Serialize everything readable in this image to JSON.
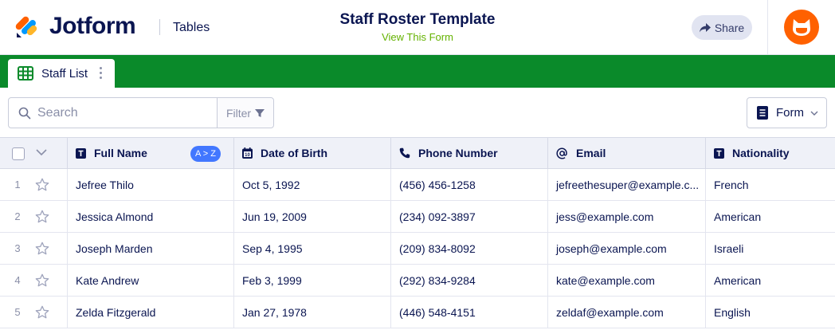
{
  "header": {
    "brand": "Jotform",
    "app_name": "Tables",
    "title": "Staff Roster Template",
    "subtitle": "View This Form",
    "share_label": "Share"
  },
  "tabs": [
    {
      "label": "Staff List",
      "icon": "table-grid-icon"
    }
  ],
  "toolbar": {
    "search_placeholder": "Search",
    "filter_label": "Filter",
    "form_label": "Form"
  },
  "table": {
    "sort_badge": "A > Z",
    "columns": [
      {
        "label": "Full Name",
        "icon": "text-type-icon"
      },
      {
        "label": "Date of Birth",
        "icon": "calendar-icon"
      },
      {
        "label": "Phone Number",
        "icon": "phone-icon"
      },
      {
        "label": "Email",
        "icon": "at-sign-icon"
      },
      {
        "label": "Nationality",
        "icon": "text-type-icon"
      }
    ],
    "rows": [
      {
        "num": "1",
        "name": "Jefree Thilo",
        "dob": "Oct 5, 1992",
        "phone": "(456) 456-1258",
        "email": "jefreethesuper@example.c...",
        "nationality": "French"
      },
      {
        "num": "2",
        "name": "Jessica Almond",
        "dob": "Jun 19, 2009",
        "phone": "(234) 092-3897",
        "email": "jess@example.com",
        "nationality": "American"
      },
      {
        "num": "3",
        "name": "Joseph Marden",
        "dob": "Sep 4, 1995",
        "phone": "(209) 834-8092",
        "email": "joseph@example.com",
        "nationality": "Israeli"
      },
      {
        "num": "4",
        "name": "Kate Andrew",
        "dob": "Feb 3, 1999",
        "phone": "(292) 834-9284",
        "email": "kate@example.com",
        "nationality": "American"
      },
      {
        "num": "5",
        "name": "Zelda Fitzgerald",
        "dob": "Jan 27, 1978",
        "phone": "(446) 548-4151",
        "email": "zeldaf@example.com",
        "nationality": "English"
      }
    ]
  },
  "colors": {
    "brand_navy": "#0a1551",
    "tab_bar_green": "#0a8a2a",
    "subtitle_green": "#64b200",
    "avatar_orange": "#ff6100",
    "sort_badge_blue": "#4277ff"
  }
}
